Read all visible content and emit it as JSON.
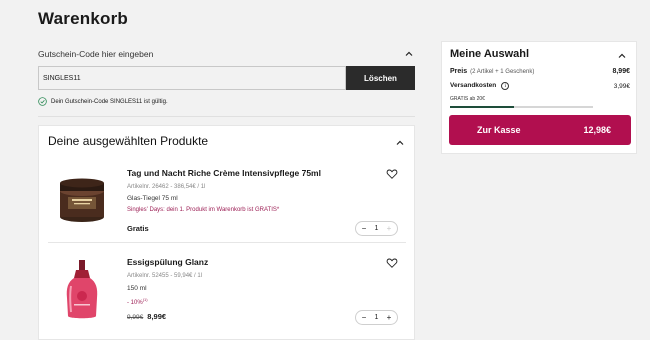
{
  "page": {
    "title": "Warenkorb"
  },
  "coupon": {
    "header": "Gutschein-Code hier eingeben",
    "value": "SINGLES11",
    "remove_label": "Löschen",
    "message": "Dein Gutschein-Code SINGLES11 ist gültig."
  },
  "products": {
    "header": "Deine ausgewählten Produkte",
    "items": [
      {
        "name": "Tag und Nacht Riche Crème Intensivpflege 75ml",
        "meta": "Artikelnr. 26462 - 386,54€ / 1l",
        "size": "Glas-Tiegel 75 ml",
        "promo": "Singles' Days: dein 1. Produkt im Warenkorb ist GRATIS*",
        "price": "Gratis",
        "quantity": "1"
      },
      {
        "name": "Essigspülung Glanz",
        "meta": "Artikelnr. 52455 - 59,94€ / 1l",
        "size": "150 ml",
        "discount": "- 10%",
        "discount_sup": "(1)",
        "old_price": "9,99€",
        "price": "8,99€",
        "quantity": "1"
      }
    ]
  },
  "summary": {
    "title": "Meine Auswahl",
    "price_label": "Preis",
    "price_sub": "(2 Artikel + 1 Geschenk)",
    "price_value": "8,99€",
    "shipping_label": "Versandkosten",
    "shipping_value": "3,99€",
    "free_shipping_label": "GRATIS ab 20€",
    "free_shipping_progress": 0.45,
    "checkout_label": "Zur Kasse",
    "checkout_total": "12,98€"
  },
  "colors": {
    "accent": "#b10f4f",
    "promo": "#9c1f55",
    "progress": "#1e4d3a",
    "success": "#2e8b57"
  }
}
